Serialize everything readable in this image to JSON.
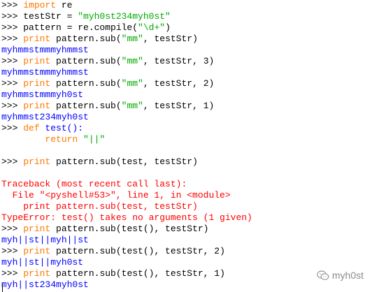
{
  "lines": [
    [
      {
        "t": ">>> ",
        "c": "p"
      },
      {
        "t": "import",
        "c": "k"
      },
      {
        "t": " re",
        "c": "p"
      }
    ],
    [
      {
        "t": ">>> testStr = ",
        "c": "p"
      },
      {
        "t": "\"myh0st234myh0st\"",
        "c": "s"
      }
    ],
    [
      {
        "t": ">>> pattern = re.compile(",
        "c": "p"
      },
      {
        "t": "\"\\d+\"",
        "c": "s"
      },
      {
        "t": ")",
        "c": "p"
      }
    ],
    [
      {
        "t": ">>> ",
        "c": "p"
      },
      {
        "t": "print",
        "c": "k"
      },
      {
        "t": " pattern.sub(",
        "c": "p"
      },
      {
        "t": "\"mm\"",
        "c": "s"
      },
      {
        "t": ", testStr)",
        "c": "p"
      }
    ],
    [
      {
        "t": "myhmmstmmmyhmmst",
        "c": "o"
      }
    ],
    [
      {
        "t": ">>> ",
        "c": "p"
      },
      {
        "t": "print",
        "c": "k"
      },
      {
        "t": " pattern.sub(",
        "c": "p"
      },
      {
        "t": "\"mm\"",
        "c": "s"
      },
      {
        "t": ", testStr, 3)",
        "c": "p"
      }
    ],
    [
      {
        "t": "myhmmstmmmyhmmst",
        "c": "o"
      }
    ],
    [
      {
        "t": ">>> ",
        "c": "p"
      },
      {
        "t": "print",
        "c": "k"
      },
      {
        "t": " pattern.sub(",
        "c": "p"
      },
      {
        "t": "\"mm\"",
        "c": "s"
      },
      {
        "t": ", testStr, 2)",
        "c": "p"
      }
    ],
    [
      {
        "t": "myhmmstmmmyh0st",
        "c": "o"
      }
    ],
    [
      {
        "t": ">>> ",
        "c": "p"
      },
      {
        "t": "print",
        "c": "k"
      },
      {
        "t": " pattern.sub(",
        "c": "p"
      },
      {
        "t": "\"mm\"",
        "c": "s"
      },
      {
        "t": ", testStr, 1)",
        "c": "p"
      }
    ],
    [
      {
        "t": "myhmmst234myh0st",
        "c": "o"
      }
    ],
    [
      {
        "t": ">>> ",
        "c": "p"
      },
      {
        "t": "def",
        "c": "k"
      },
      {
        "t": " test():",
        "c": "d"
      }
    ],
    [
      {
        "t": "        ",
        "c": "p"
      },
      {
        "t": "return",
        "c": "k"
      },
      {
        "t": " ",
        "c": "p"
      },
      {
        "t": "\"||\"",
        "c": "s"
      }
    ],
    [
      {
        "t": "",
        "c": "p"
      }
    ],
    [
      {
        "t": ">>> ",
        "c": "p"
      },
      {
        "t": "print",
        "c": "k"
      },
      {
        "t": " pattern.sub(test, testStr)",
        "c": "p"
      }
    ],
    [
      {
        "t": "",
        "c": "p"
      }
    ],
    [
      {
        "t": "Traceback (most recent call last):",
        "c": "e"
      }
    ],
    [
      {
        "t": "  File \"<pyshell#53>\", line 1, in <module>",
        "c": "e"
      }
    ],
    [
      {
        "t": "    print pattern.sub(test, testStr)",
        "c": "e"
      }
    ],
    [
      {
        "t": "TypeError: test() takes no arguments (1 given)",
        "c": "e"
      }
    ],
    [
      {
        "t": ">>> ",
        "c": "p"
      },
      {
        "t": "print",
        "c": "k"
      },
      {
        "t": " pattern.sub(test(), testStr)",
        "c": "p"
      }
    ],
    [
      {
        "t": "myh||st||myh||st",
        "c": "o"
      }
    ],
    [
      {
        "t": ">>> ",
        "c": "p"
      },
      {
        "t": "print",
        "c": "k"
      },
      {
        "t": " pattern.sub(test(), testStr, 2)",
        "c": "p"
      }
    ],
    [
      {
        "t": "myh||st||myh0st",
        "c": "o"
      }
    ],
    [
      {
        "t": ">>> ",
        "c": "p"
      },
      {
        "t": "print",
        "c": "k"
      },
      {
        "t": " pattern.sub(test(), testStr, 1)",
        "c": "p"
      }
    ],
    [
      {
        "t": "myh||st234myh0st",
        "c": "o"
      }
    ]
  ],
  "watermark": {
    "text": "myh0st",
    "icon": "wechat-icon"
  },
  "colors": {
    "keyword": "#ff7700",
    "string": "#00aa00",
    "output": "#0000ff",
    "error": "#ff0000",
    "plain": "#000000"
  }
}
